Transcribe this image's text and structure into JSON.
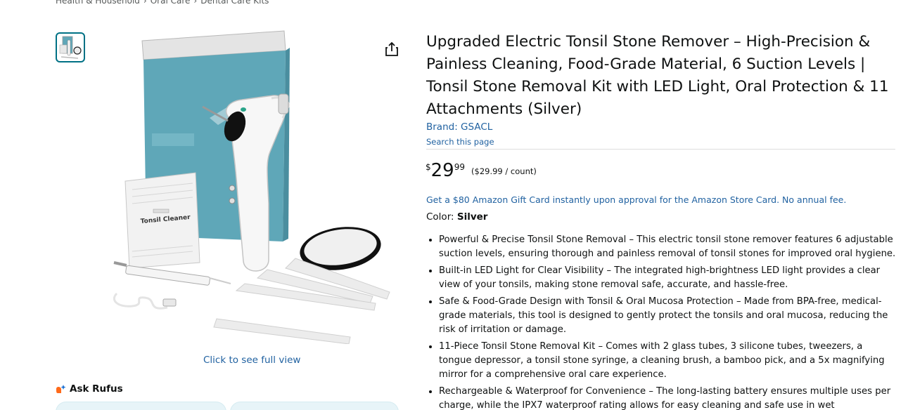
{
  "breadcrumb": [
    "Health & Household",
    "Oral Care",
    "Dental Care Kits"
  ],
  "breadcrumb_sep": "›",
  "product": {
    "title": "Upgraded Electric Tonsil Stone Remover – High-Precision & Painless Cleaning, Food-Grade Material, 6 Suction Levels | Tonsil Stone Removal Kit with LED Light, Oral Protection & 11 Attachments (Silver)",
    "brand_link": "Brand: GSACL",
    "search_page": "Search this page",
    "price_symbol": "$",
    "price_whole": "29",
    "price_fraction": "99",
    "unit_price": "($29.99 / count)",
    "gift_offer": "Get a $80 Amazon Gift Card instantly upon approval for the Amazon Store Card. No annual fee.",
    "color_label": "Color: ",
    "color_value": "Silver",
    "bullets": [
      "Powerful & Precise Tonsil Stone Removal – This electric tonsil stone remover features 6 adjustable suction levels, ensuring thorough and painless removal of tonsil stones for improved oral hygiene.",
      "Built-in LED Light for Clear Visibility – The integrated high-brightness LED light provides a clear view of your tonsils, making stone removal safe, accurate, and hassle-free.",
      "Safe & Food-Grade Design with Tonsil & Oral Mucosa Protection – Made from BPA-free, medical-grade materials, this tool is designed to gently protect the tonsils and oral mucosa, reducing the risk of irritation or damage.",
      "11-Piece Tonsil Stone Removal Kit – Comes with 2 glass tubes, 3 silicone tubes, tweezers, a tongue depressor, a tonsil stone syringe, a cleaning brush, a bamboo pick, and a 5x magnifying mirror for a comprehensive oral care experience.",
      "Rechargeable & Waterproof for Convenience – The long-lasting battery ensures multiple uses per charge, while the IPX7 waterproof rating allows for easy cleaning and safe use in wet environments."
    ]
  },
  "gallery": {
    "click_full_view": "Click to see full view",
    "package_text": "Tonsil Cleaner"
  },
  "rufus": {
    "label": "Ask Rufus"
  },
  "colors": {
    "link": "#2162a1",
    "text": "#0f1111",
    "accent_box": "#5fa7b8"
  }
}
